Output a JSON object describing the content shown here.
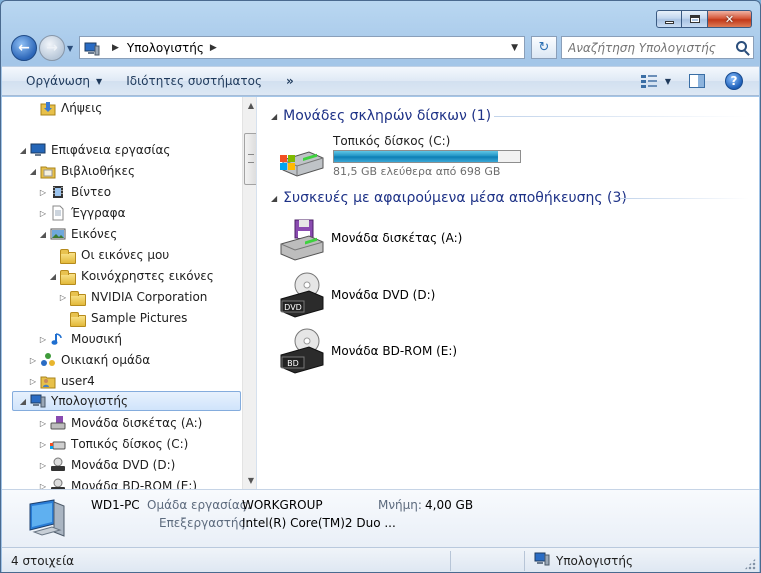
{
  "window": {
    "caption_min": "minimize",
    "caption_max": "maximize",
    "caption_close": "✕"
  },
  "address": {
    "crumb": "Υπολογιστής",
    "search_placeholder": "Αναζήτηση Υπολογιστής"
  },
  "toolbar": {
    "organize": "Οργάνωση",
    "system_properties": "Ιδιότητες συστήματος",
    "more": "»",
    "help": "?"
  },
  "tree": [
    {
      "label": "Λήψεις",
      "icon": "folder-downloads-icon"
    },
    {
      "label": "Επιφάνεια εργασίας",
      "icon": "desktop-icon"
    },
    {
      "label": "Βιβλιοθήκες",
      "icon": "libraries-icon"
    },
    {
      "label": "Βίντεο",
      "icon": "videos-icon"
    },
    {
      "label": "Έγγραφα",
      "icon": "documents-icon"
    },
    {
      "label": "Εικόνες",
      "icon": "pictures-icon"
    },
    {
      "label": "Οι εικόνες μου",
      "icon": "folder-icon"
    },
    {
      "label": "Κοινόχρηστες εικόνες",
      "icon": "folder-icon"
    },
    {
      "label": "NVIDIA Corporation",
      "icon": "folder-icon"
    },
    {
      "label": "Sample Pictures",
      "icon": "folder-icon"
    },
    {
      "label": "Μουσική",
      "icon": "music-icon"
    },
    {
      "label": "Οικιακή ομάδα",
      "icon": "homegroup-icon"
    },
    {
      "label": "user4",
      "icon": "user-folder-icon"
    },
    {
      "label": "Υπολογιστής",
      "icon": "computer-icon"
    },
    {
      "label": "Μονάδα δισκέτας (A:)",
      "icon": "floppy-drive-icon"
    },
    {
      "label": "Τοπικός δίσκος (C:)",
      "icon": "local-disk-icon"
    },
    {
      "label": "Μονάδα DVD (D:)",
      "icon": "dvd-drive-icon"
    },
    {
      "label": "Μονάδα BD-ROM (E:)",
      "icon": "bd-drive-icon"
    }
  ],
  "main": {
    "hdd_header": "Μονάδες σκληρών δίσκων (1)",
    "removable_header": "Συσκευές με αφαιρούμενα μέσα αποθήκευσης (3)",
    "local_disk": {
      "name": "Τοπικός δίσκος (C:)",
      "free_text": "81,5 GB ελεύθερα από 698 GB",
      "used_fraction": 0.883
    },
    "floppy": "Μονάδα δισκέτας (A:)",
    "dvd": "Μονάδα DVD (D:)",
    "dvd_badge": "DVD",
    "bd": "Μονάδα BD-ROM (E:)",
    "bd_badge": "BD"
  },
  "details": {
    "pc_name": "WD1-PC",
    "workgroup_key": "Ομάδα εργασίας:",
    "workgroup_val": "WORKGROUP",
    "memory_key": "Μνήμη:",
    "memory_val": "4,00 GB",
    "processor_key": "Επεξεργαστής:",
    "processor_val": "Intel(R) Core(TM)2 Duo ..."
  },
  "status": {
    "count": "4 στοιχεία",
    "location": "Υπολογιστής"
  },
  "colors": {
    "header_blue": "#1e3287",
    "bar_blue": "#1b8fc2"
  }
}
